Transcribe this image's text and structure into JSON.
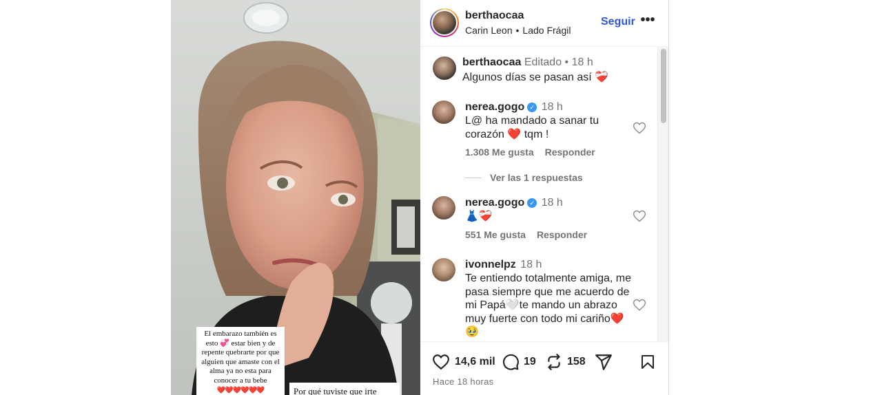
{
  "post": {
    "username": "berthaocaa",
    "audio_artist": "Carin Leon",
    "audio_separator": "•",
    "audio_song": "Lado Frágil",
    "follow_label": "Seguir",
    "more_label": "•••",
    "media_text": {
      "card_lines": "El embarazo también es esto 💞 estar bien y de repente quebrarte por que alguien que amaste con el alma ya no esta para conocer a tu bebe",
      "card_hearts": "❤️❤️❤️❤️❤️❤️",
      "card2": "Por qué tuviste que irte"
    }
  },
  "caption": {
    "username": "berthaocaa",
    "edited": "Editado",
    "dot": "•",
    "time": "18 h",
    "text": "Algunos días se pasan así ❤️‍🩹"
  },
  "comments": [
    {
      "username": "nerea.gogo",
      "verified": true,
      "time": "18 h",
      "text": "L@ ha mandado a sanar tu corazón ❤️ tqm !",
      "likes": "1.308 Me gusta",
      "reply_label": "Responder",
      "replies_label": "Ver las 1 respuestas"
    },
    {
      "username": "nerea.gogo",
      "verified": true,
      "time": "18 h",
      "text": "👗❤️‍🩹",
      "likes": "551 Me gusta",
      "reply_label": "Responder"
    },
    {
      "username": "ivonnelpz",
      "verified": false,
      "time": "18 h",
      "text": "Te entiendo totalmente amiga, me pasa siempre que me acuerdo de mi Papá🤍te mando un abrazo muy fuerte con todo mi cariño❤️🥹"
    }
  ],
  "footer": {
    "likes_count": "14,6 mil",
    "comments_count": "19",
    "reposts_count": "158",
    "time_ago": "Hace 18 horas"
  },
  "icons": {
    "like": "heart-icon",
    "comment": "comment-icon",
    "repost": "repost-icon",
    "share": "share-icon",
    "save": "bookmark-icon",
    "verified": "verified-badge-icon"
  },
  "colors": {
    "link_blue": "#2f57d6",
    "verified_blue": "#3897f0",
    "muted": "#737373"
  }
}
